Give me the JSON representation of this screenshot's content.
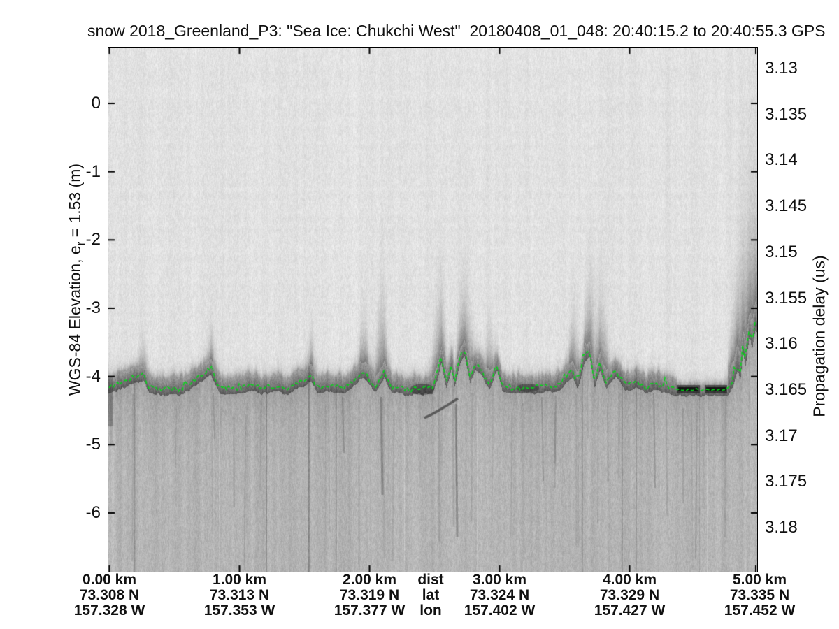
{
  "title": "snow 2018_Greenland_P3: \"Sea Ice: Chukchi West\"  20180408_01_048: 20:40:15.2 to 20:40:55.3 GPS",
  "y_axis_left": {
    "label_prefix": "WGS-84 Elevation, e",
    "label_sub": "r",
    "label_suffix": " = 1.53 (m)",
    "ticks": [
      "0",
      "-1",
      "-2",
      "-3",
      "-4",
      "-5",
      "-6"
    ]
  },
  "y_axis_right": {
    "label": "Propagation delay (us)",
    "ticks": [
      "3.13",
      "3.135",
      "3.14",
      "3.145",
      "3.15",
      "3.155",
      "3.16",
      "3.165",
      "3.17",
      "3.175",
      "3.18"
    ]
  },
  "x_axis": {
    "legend": {
      "dist": "dist",
      "lat": "lat",
      "lon": "lon"
    },
    "columns": [
      {
        "dist": "0.00 km",
        "lat": "73.308 N",
        "lon": "157.328 W"
      },
      {
        "dist": "1.00 km",
        "lat": "73.313 N",
        "lon": "157.353 W"
      },
      {
        "dist": "2.00 km",
        "lat": "73.319 N",
        "lon": "157.377 W"
      },
      {
        "dist": "3.00 km",
        "lat": "73.324 N",
        "lon": "157.402 W"
      },
      {
        "dist": "4.00 km",
        "lat": "73.329 N",
        "lon": "157.427 W"
      },
      {
        "dist": "5.00 km",
        "lat": "73.335 N",
        "lon": "157.452 W"
      }
    ]
  },
  "colors": {
    "surface_pick_green": "#02d816",
    "text": "#111111",
    "background": "#ffffff"
  },
  "chart_data": {
    "type": "heatmap",
    "subtype": "radar-echogram",
    "title": "snow 2018_Greenland_P3: \"Sea Ice: Chukchi West\"  20180408_01_048: 20:40:15.2 to 20:40:55.3 GPS",
    "xlabel": "dist / lat / lon",
    "ylabel_left": "WGS-84 Elevation, e_r = 1.53 (m)",
    "ylabel_right": "Propagation delay (us)",
    "x_range_km": [
      0,
      5.0
    ],
    "elevation_range_m": [
      0.82,
      -6.86
    ],
    "delay_range_us": [
      3.1277,
      3.1847
    ],
    "x_ticks_km": [
      0,
      1,
      2,
      3,
      4,
      5
    ],
    "elevation_ticks_m": [
      0,
      -1,
      -2,
      -3,
      -4,
      -5,
      -6
    ],
    "delay_ticks_us": [
      3.13,
      3.135,
      3.14,
      3.145,
      3.15,
      3.155,
      3.16,
      3.165,
      3.17,
      3.175,
      3.18
    ],
    "geo_refs": {
      "dist_km": [
        "0.00",
        "1.00",
        "2.00",
        "3.00",
        "4.00",
        "5.00"
      ],
      "lat_N": [
        73.308,
        73.313,
        73.319,
        73.324,
        73.329,
        73.335
      ],
      "lon_W": [
        157.328,
        157.353,
        157.377,
        157.402,
        157.427,
        157.452
      ]
    },
    "surface_pick": {
      "color": "#02d816",
      "dist_km": [
        0.0,
        0.26,
        0.31,
        0.55,
        0.78,
        0.85,
        1.01,
        1.09,
        1.17,
        1.28,
        1.36,
        1.55,
        1.6,
        1.69,
        1.77,
        1.85,
        1.95,
        2.04,
        2.11,
        2.17,
        2.25,
        2.33,
        2.41,
        2.48,
        2.52,
        2.55,
        2.59,
        2.63,
        2.65,
        2.7,
        2.73,
        2.77,
        2.81,
        2.87,
        2.92,
        2.98,
        3.02,
        3.14,
        3.24,
        3.41,
        3.46,
        3.56,
        3.6,
        3.65,
        3.69,
        3.73,
        3.77,
        3.82,
        3.89,
        3.97,
        4.05,
        4.13,
        4.21,
        4.29,
        4.36,
        4.75,
        4.79,
        4.83,
        4.85,
        4.87,
        4.89,
        4.92,
        4.94,
        4.97,
        4.98
      ],
      "elevation_m": [
        -4.15,
        -3.96,
        -4.17,
        -4.18,
        -3.89,
        -4.16,
        -4.17,
        -4.1,
        -4.16,
        -4.11,
        -4.17,
        -3.98,
        -4.15,
        -4.12,
        -4.16,
        -4.1,
        -3.91,
        -4.14,
        -3.93,
        -4.14,
        -4.17,
        -4.18,
        -4.16,
        -4.17,
        -3.96,
        -3.71,
        -4.1,
        -3.76,
        -4.07,
        -3.66,
        -3.6,
        -4.01,
        -3.81,
        -3.91,
        -4.1,
        -3.81,
        -4.12,
        -4.15,
        -4.16,
        -4.12,
        -4.1,
        -3.91,
        -4.1,
        -3.71,
        -3.6,
        -4.07,
        -3.81,
        -4.08,
        -3.91,
        -4.12,
        -4.07,
        -4.14,
        -4.1,
        -4.15,
        -4.19,
        -4.19,
        -4.07,
        -3.81,
        -3.96,
        -3.55,
        -3.76,
        -3.3,
        -3.5,
        -3.19,
        -3.3
      ]
    },
    "features": [
      {
        "type": "sea-ice surface return band",
        "elevation_m": -4.1,
        "extent_km": [
          0,
          5
        ]
      },
      {
        "type": "dark flat lead (specular return)",
        "dist_km": [
          4.37,
          4.74
        ],
        "elevation_m": -4.2
      },
      {
        "type": "pressure ridge / rough ice rise",
        "dist_km": [
          4.8,
          5.0
        ],
        "elevation_top_m": -3.2
      },
      {
        "type": "hummocky rough surface",
        "dist_km": [
          2.5,
          3.0
        ]
      },
      {
        "type": "hummocky rough surface",
        "dist_km": [
          3.55,
          3.95
        ]
      },
      {
        "type": "off-nadir diagonal clutter streak",
        "dist_km": [
          2.44,
          2.67
        ],
        "elevation_m": -4.5
      }
    ]
  }
}
